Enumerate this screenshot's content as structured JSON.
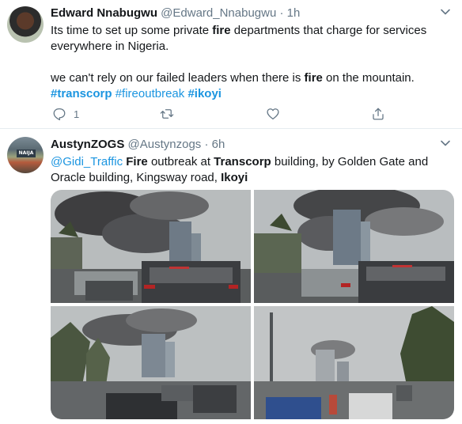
{
  "tweets": [
    {
      "author_name": "Edward Nnabugwu",
      "handle": "@Edward_Nnabugwu",
      "separator": "·",
      "time": "1h",
      "text": {
        "p1_a": "Its time to set up some private ",
        "p1_b": "fire",
        "p1_c": " departments that charge for services everywhere in Nigeria.",
        "p2_a": "we can't rely on our failed leaders when there is ",
        "p2_b": "fire",
        "p2_c": " on the mountain.",
        "tags": [
          "#transcorp",
          "#fireoutbreak",
          "#ikoyi"
        ]
      },
      "actions": {
        "reply_count": "1"
      }
    },
    {
      "author_name": "AustynZOGS",
      "handle": "@Austynzogs",
      "separator": "·",
      "time": "6h",
      "avatar_badge": "NAIJA",
      "text": {
        "mention": "@Gidi_Traffic",
        "a": "Fire",
        "b": " outbreak at ",
        "c": "Transcorp",
        "d": " building, by Golden Gate and Oracle building, Kingsway road, ",
        "e": "Ikoyi"
      }
    }
  ],
  "colors": {
    "link": "#1b95e0",
    "secondary": "#657786",
    "text": "#14171a",
    "divider": "#e6ecf0"
  },
  "icons": {
    "reply": "reply-icon",
    "retweet": "retweet-icon",
    "like": "heart-icon",
    "share": "share-icon",
    "menu": "chevron-down-icon"
  }
}
